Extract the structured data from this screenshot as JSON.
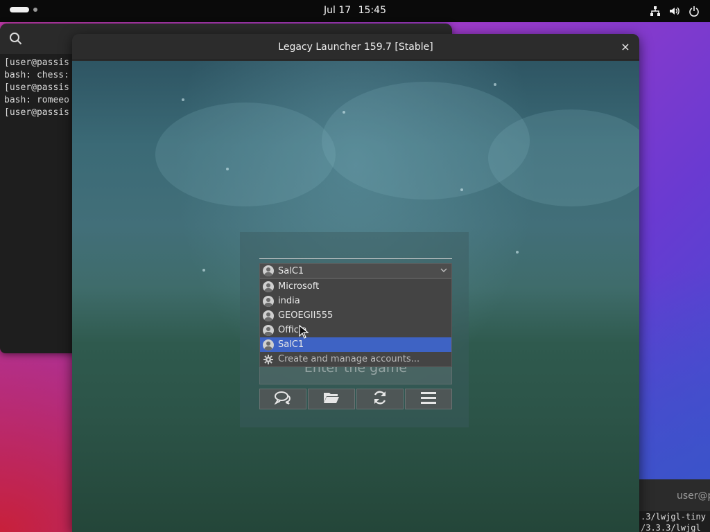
{
  "topbar": {
    "date": "Jul 17",
    "time": "15:45"
  },
  "terminal": {
    "lines": [
      "[user@passis",
      "bash: chess:",
      "[user@passis",
      "bash: romeeo",
      "[user@passis"
    ]
  },
  "terminal2": {
    "header": "user@p",
    "lines": [
      ".3/lwjgl-tiny",
      "/3.3.3/lwjgl"
    ]
  },
  "launcher": {
    "title": "Legacy Launcher 159.7 [Stable]",
    "close": "×",
    "account_selected": "SalC1",
    "accounts": [
      {
        "label": "Microsoft",
        "selected": false
      },
      {
        "label": "india",
        "selected": false
      },
      {
        "label": "GEOEGII555",
        "selected": false
      },
      {
        "label": "Officla",
        "selected": false
      },
      {
        "label": "SalC1",
        "selected": true
      }
    ],
    "manage_label": "Create and manage accounts...",
    "enter_label": "Enter the game",
    "toolbar": [
      {
        "icon": "chat-icon"
      },
      {
        "icon": "folder-icon"
      },
      {
        "icon": "refresh-icon"
      },
      {
        "icon": "menu-icon"
      }
    ]
  }
}
